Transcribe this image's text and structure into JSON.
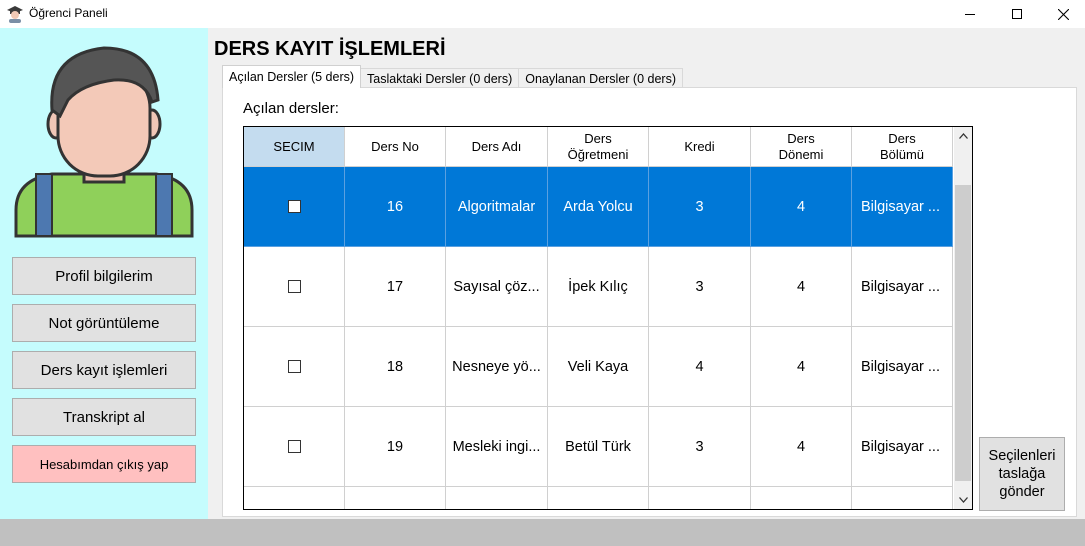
{
  "window": {
    "title": "Öğrenci Paneli",
    "icon": "student-graduate-icon",
    "controls": [
      "minimize-icon",
      "maximize-icon",
      "close-icon"
    ]
  },
  "sidebar": {
    "avatar": "student-avatar-icon",
    "buttons": [
      {
        "label": "Profil bilgilerim"
      },
      {
        "label": "Not görüntüleme"
      },
      {
        "label": "Ders kayıt işlemleri"
      },
      {
        "label": "Transkript al"
      },
      {
        "label": "Hesabımdan çıkış yap"
      }
    ],
    "background_color": "#c5fcfd",
    "logout_color": "#ffc0c0"
  },
  "main": {
    "title": "DERS KAYIT İŞLEMLERİ",
    "tabs": [
      {
        "label": "Açılan Dersler (5 ders)",
        "active": true
      },
      {
        "label": "Taslaktaki Dersler (0 ders)",
        "active": false
      },
      {
        "label": "Onaylanan Dersler (0 ders)",
        "active": false
      }
    ],
    "list_label": "Açılan dersler:",
    "grid": {
      "columns": [
        "SECIM",
        "Ders No",
        "Ders Adı",
        "Ders\nÖğretmeni",
        "Kredi",
        "Ders\nDönemi",
        "Ders\nBölümü"
      ],
      "rows": [
        {
          "no": "16",
          "name": "Algoritmalar",
          "teacher": "Arda Yolcu",
          "credit": "3",
          "term": "4",
          "dept": "Bilgisayar ...",
          "selected": true
        },
        {
          "no": "17",
          "name": "Sayısal çöz...",
          "teacher": "İpek Kılıç",
          "credit": "3",
          "term": "4",
          "dept": "Bilgisayar ...",
          "selected": false
        },
        {
          "no": "18",
          "name": "Nesneye yö...",
          "teacher": "Veli Kaya",
          "credit": "4",
          "term": "4",
          "dept": "Bilgisayar ...",
          "selected": false
        },
        {
          "no": "19",
          "name": "Mesleki ingi...",
          "teacher": "Betül Türk",
          "credit": "3",
          "term": "4",
          "dept": "Bilgisayar ...",
          "selected": false
        },
        {
          "no": "",
          "name": "",
          "teacher": "",
          "credit": "",
          "term": "",
          "dept": "",
          "selected": false
        }
      ],
      "selected_color": "#0078d7",
      "header_selected_color": "#c4dcef"
    },
    "send_button": "Seçilenleri taslağa gönder"
  }
}
